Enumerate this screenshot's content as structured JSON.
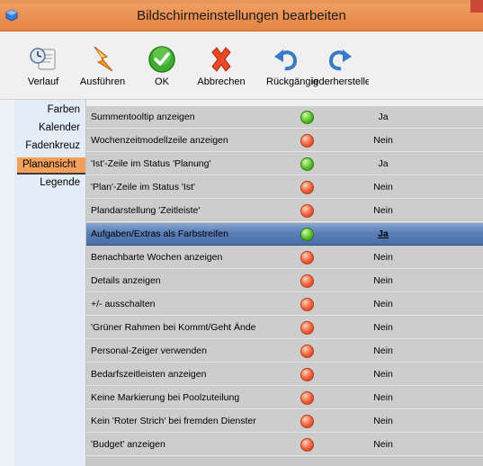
{
  "window": {
    "title": "Bildschirmeinstellungen bearbeiten"
  },
  "toolbar": {
    "items": [
      {
        "label": "Verlauf"
      },
      {
        "label": "Ausführen"
      },
      {
        "label": "OK"
      },
      {
        "label": "Abbrechen"
      },
      {
        "label": "Rückgängig"
      },
      {
        "label": "iederherstelle"
      }
    ]
  },
  "sidebar": {
    "items": [
      {
        "label": "Farben"
      },
      {
        "label": "Kalender"
      },
      {
        "label": "Fadenkreuz"
      },
      {
        "label": "Planansicht",
        "active": true
      },
      {
        "label": "Legende"
      }
    ]
  },
  "settings": {
    "rows": [
      {
        "label": "Summentooltip anzeigen",
        "status": "green",
        "value": "Ja"
      },
      {
        "label": "Wochenzeitmodellzeile anzeigen",
        "status": "red",
        "value": "Nein"
      },
      {
        "label": "'Ist'-Zeile im Status 'Planung'",
        "status": "green",
        "value": "Ja"
      },
      {
        "label": "'Plan'-Zeile im Status 'Ist'",
        "status": "red",
        "value": "Nein"
      },
      {
        "label": "Plandarstellung 'Zeitleiste'",
        "status": "red",
        "value": "Nein"
      },
      {
        "label": "Aufgaben/Extras als Farbstreifen",
        "status": "green",
        "value": "Ja",
        "selected": true
      },
      {
        "label": "Benachbarte Wochen anzeigen",
        "status": "red",
        "value": "Nein"
      },
      {
        "label": "Details anzeigen",
        "status": "red",
        "value": "Nein"
      },
      {
        "label": "+/- ausschalten",
        "status": "red",
        "value": "Nein"
      },
      {
        "label": "'Grüner Rahmen bei Kommt/Geht Ände",
        "status": "red",
        "value": "Nein"
      },
      {
        "label": "Personal-Zeiger verwenden",
        "status": "red",
        "value": "Nein"
      },
      {
        "label": "Bedarfszeitleisten anzeigen",
        "status": "red",
        "value": "Nein"
      },
      {
        "label": "Keine Markierung bei Poolzuteilung",
        "status": "red",
        "value": "Nein"
      },
      {
        "label": "Kein 'Roter Strich' bei fremden Dienster",
        "status": "red",
        "value": "Nein"
      },
      {
        "label": "'Budget' anzeigen",
        "status": "red",
        "value": "Nein"
      }
    ]
  }
}
